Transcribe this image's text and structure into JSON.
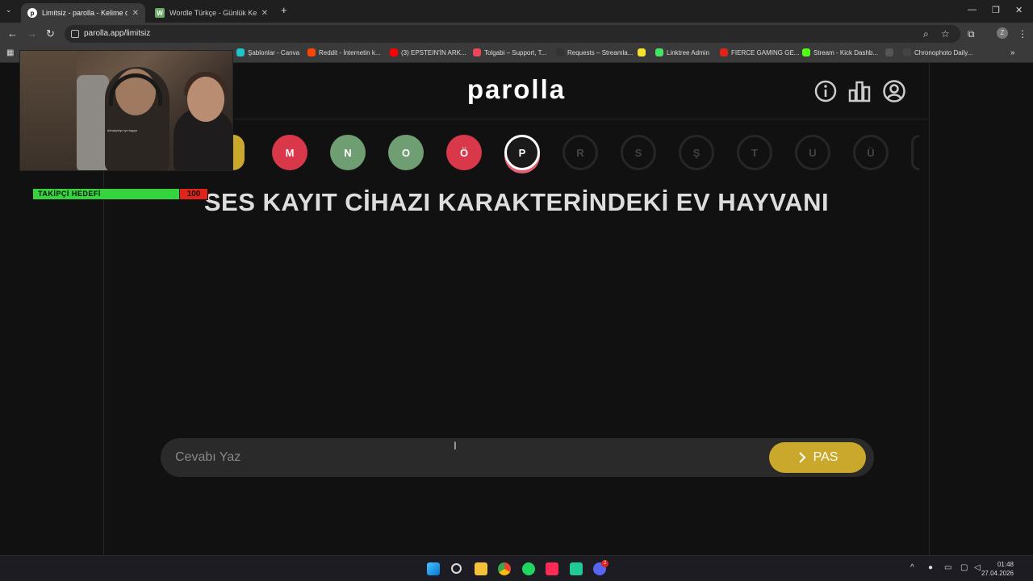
{
  "browser": {
    "tabs": [
      {
        "title": "Limitsiz - parolla - Kelime oyunu",
        "active": true
      },
      {
        "title": "Wordle Türkçe - Günlük Kelime",
        "active": false
      }
    ],
    "new_tab_symbol": "+",
    "url": "parolla.app/limitsiz",
    "bookmarks": [
      {
        "label": "Şablonlar - Canva",
        "color": "#20c4cb"
      },
      {
        "label": "Reddit - İnternetin k...",
        "color": "#ff4500"
      },
      {
        "label": "(3) EPSTEIN'İN ARK...",
        "color": "#ff0000"
      },
      {
        "label": "Tolgabi – Support, T...",
        "color": "#e8485a"
      },
      {
        "label": "Requests – Streamla...",
        "color": "#333333"
      },
      {
        "label": "",
        "color": "#f7e130"
      },
      {
        "label": "Linktree Admin",
        "color": "#43e660"
      },
      {
        "label": "FIERCE GAMING GE...",
        "color": "#e2231a"
      },
      {
        "label": "Stream - Kick Dashb...",
        "color": "#53fc18"
      },
      {
        "label": "",
        "color": "#555555"
      },
      {
        "label": "Chronophoto Daily...",
        "color": "#444444"
      }
    ]
  },
  "app": {
    "logo": "parolla",
    "icons": [
      "info-icon",
      "stats-icon",
      "user-icon"
    ],
    "letters": [
      {
        "letter": "",
        "state": "correct",
        "color": "#c9a82b",
        "partial": true
      },
      {
        "letter": "M",
        "state": "wrong",
        "color": "#d8384a"
      },
      {
        "letter": "N",
        "state": "correct",
        "color": "#6f9e72"
      },
      {
        "letter": "O",
        "state": "correct",
        "color": "#6f9e72"
      },
      {
        "letter": "Ö",
        "state": "wrong",
        "color": "#d8384a"
      },
      {
        "letter": "P",
        "state": "current",
        "color": "#1a1a1a"
      },
      {
        "letter": "R",
        "state": "pending"
      },
      {
        "letter": "S",
        "state": "pending"
      },
      {
        "letter": "Ş",
        "state": "pending"
      },
      {
        "letter": "T",
        "state": "pending"
      },
      {
        "letter": "U",
        "state": "pending"
      },
      {
        "letter": "Ü",
        "state": "pending"
      },
      {
        "letter": "",
        "state": "pending",
        "partial": true
      }
    ],
    "question": "SES KAYIT CİHAZI KARAKTERİNDEKİ EV HAYVANI",
    "answer": {
      "value": "",
      "placeholder": "Cevabı Yaz"
    },
    "pass_label": "PAS"
  },
  "overlay": {
    "goal_label": "TAKİPÇİ HEDEFİ",
    "goal_value": "100",
    "goal_progress": 0.84,
    "webcam_caption": "ddrudydqn ryo bqyys"
  },
  "taskbar": {
    "apps": [
      "windows-start",
      "search",
      "file-explorer",
      "chrome",
      "spotify",
      "tiktok",
      "app-green",
      "discord"
    ],
    "discord_badge": "2",
    "time": "01:48",
    "date": "27.04.2026"
  }
}
